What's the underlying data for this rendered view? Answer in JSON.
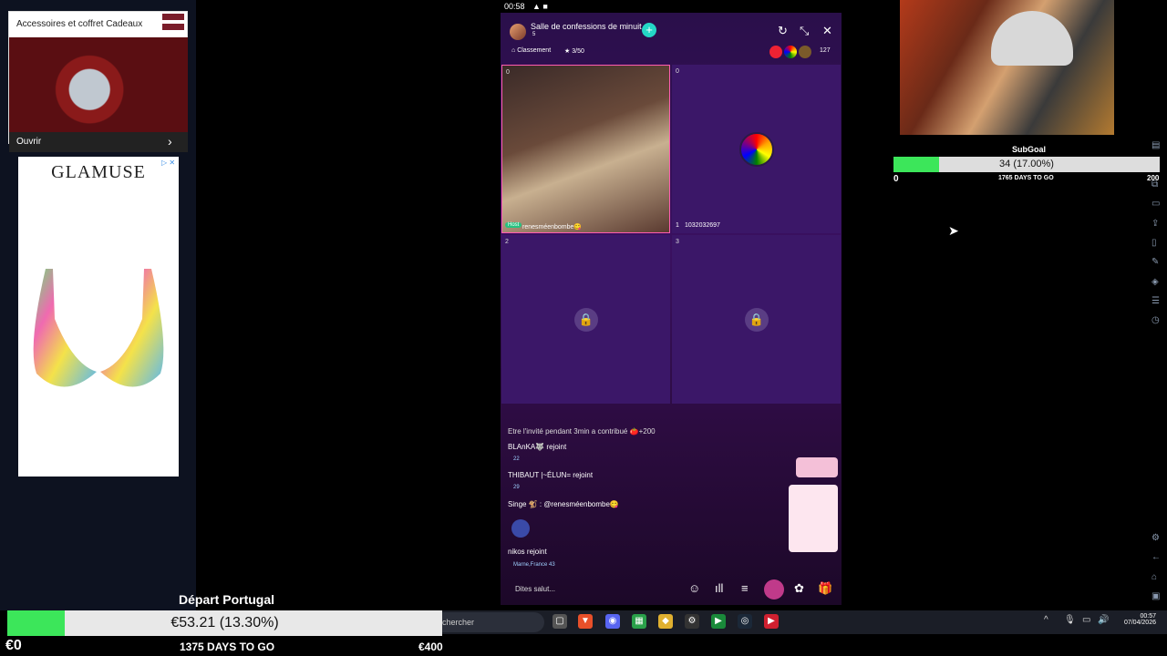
{
  "ads": {
    "ad1": {
      "title": "Accessoires et coffret Cadeaux",
      "cta": "Ouvrir"
    },
    "ad2": {
      "brand": "GLAMUSE",
      "badge": "▷ ✕"
    }
  },
  "phone": {
    "status_time": "00:58",
    "room_title": "Salle de confessions de minuit",
    "room_sub": "5",
    "ranking_label": "Classement",
    "seats_label": "3/50",
    "viewer_count": "127",
    "seats": [
      {
        "num": "0",
        "name": "renesméenbombe😋",
        "host_tag": "Host"
      },
      {
        "num": "0",
        "name": "1032032697",
        "idx": "1"
      },
      {
        "num": "2"
      },
      {
        "num": "3"
      }
    ],
    "chat": [
      {
        "text": "Etre l'invité pendant 3min a contribué 🍅+200"
      },
      {
        "text": "BLAnKA🐺 rejoint",
        "sub": "22"
      },
      {
        "text": "THIBAUT |~ÉLUN= rejoint",
        "sub": "29"
      },
      {
        "text": "Singe 🐒 : @renesméenbombe😋"
      },
      {
        "text": "nikos rejoint",
        "sub": "Marne,France   43"
      }
    ],
    "input_placeholder": "Dites salut..."
  },
  "subgoal": {
    "title": "SubGoal",
    "value_text": "34 (17.00%)",
    "progress": 0.17,
    "min": "0",
    "days": "1765 DAYS TO GO",
    "max": "200"
  },
  "donation": {
    "title": "Départ Portugal",
    "value_text": "€53.21 (13.30%)",
    "progress": 0.133,
    "min": "€0",
    "days": "1375 DAYS TO GO",
    "max": "€400"
  },
  "taskbar": {
    "search_placeholder": "chercher",
    "time": "00:57",
    "date": "07/04/2026"
  },
  "colors": {
    "goal_fill": "#3ce65a",
    "phone_bg": "#3a1060",
    "follow": "#24d7c6"
  }
}
